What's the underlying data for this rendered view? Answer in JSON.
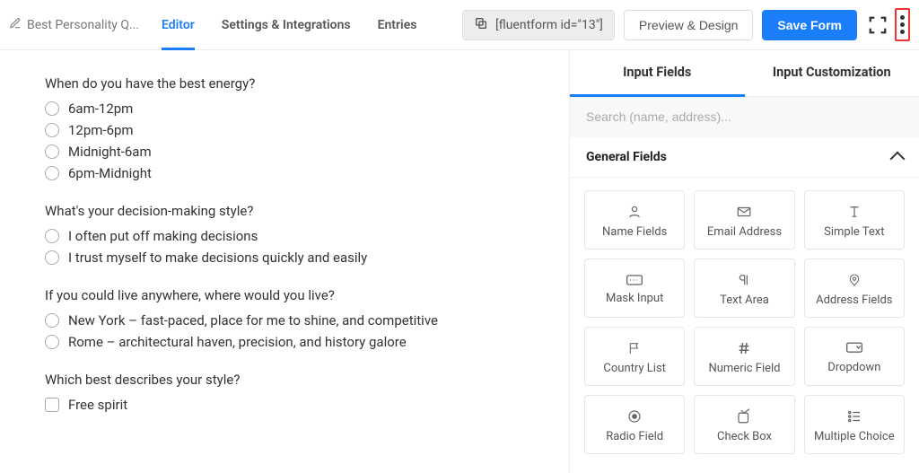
{
  "header": {
    "form_title": "Best Personality Q...",
    "tabs": {
      "editor": "Editor",
      "settings": "Settings & Integrations",
      "entries": "Entries"
    },
    "shortcode": "[fluentform id=\"13\"]",
    "preview_btn": "Preview & Design",
    "save_btn": "Save Form"
  },
  "canvas": {
    "q1": {
      "label": "When do you have the best energy?",
      "opts": [
        "6am-12pm",
        "12pm-6pm",
        "Midnight-6am",
        "6pm-Midnight"
      ]
    },
    "q2": {
      "label": "What's your decision-making style?",
      "opts": [
        "I often put off making decisions",
        "I trust myself to make decisions quickly and easily"
      ]
    },
    "q3": {
      "label": "If you could live anywhere, where would you live?",
      "opts": [
        "New York – fast-paced, place for me to shine, and competitive",
        "Rome – architectural haven, precision, and history galore"
      ]
    },
    "q4": {
      "label": "Which best describes your style?",
      "opts": [
        "Free spirit"
      ]
    }
  },
  "sidebar": {
    "tabs": {
      "input": "Input Fields",
      "custom": "Input Customization"
    },
    "search_placeholder": "Search (name, address)...",
    "section_title": "General Fields",
    "fields": [
      "Name Fields",
      "Email Address",
      "Simple Text",
      "Mask Input",
      "Text Area",
      "Address Fields",
      "Country List",
      "Numeric Field",
      "Dropdown",
      "Radio Field",
      "Check Box",
      "Multiple Choice"
    ]
  }
}
